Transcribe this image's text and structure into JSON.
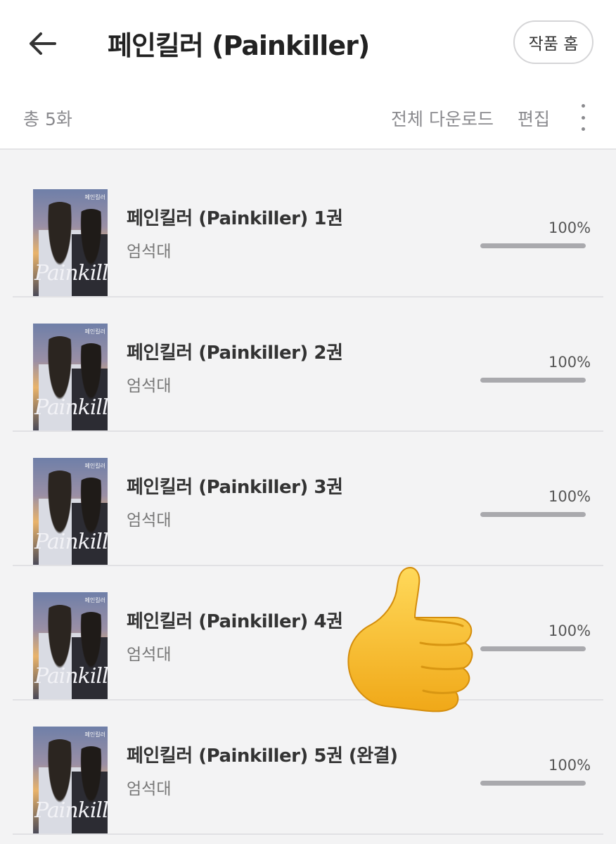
{
  "header": {
    "title": "페인킬러 (Painkiller)",
    "home_button": "작품 홈"
  },
  "toolbar": {
    "count": "총 5화",
    "download_all": "전체 다운로드",
    "edit": "편집"
  },
  "cover": {
    "title_text": "Painkiller",
    "top_text": "페인킬러"
  },
  "items": [
    {
      "title": "페인킬러 (Painkiller) 1권",
      "author": "엄석대",
      "percent": "100%",
      "progress": 1.0
    },
    {
      "title": "페인킬러 (Painkiller) 2권",
      "author": "엄석대",
      "percent": "100%",
      "progress": 1.0
    },
    {
      "title": "페인킬러 (Painkiller) 3권",
      "author": "엄석대",
      "percent": "100%",
      "progress": 1.0
    },
    {
      "title": "페인킬러 (Painkiller) 4권",
      "author": "엄석대",
      "percent": "100%",
      "progress": 1.0
    },
    {
      "title": "페인킬러 (Painkiller) 5권 (완결)",
      "author": "엄석대",
      "percent": "100%",
      "progress": 1.0
    }
  ],
  "icons": {
    "back": "arrow-left-icon",
    "more": "more-vertical-icon",
    "overlay": "thumbs-up-emoji"
  },
  "colors": {
    "background": "#f3f3f4",
    "header": "#ffffff",
    "progress_fill": "#a9a9ad",
    "emoji": "#f7c52b"
  }
}
